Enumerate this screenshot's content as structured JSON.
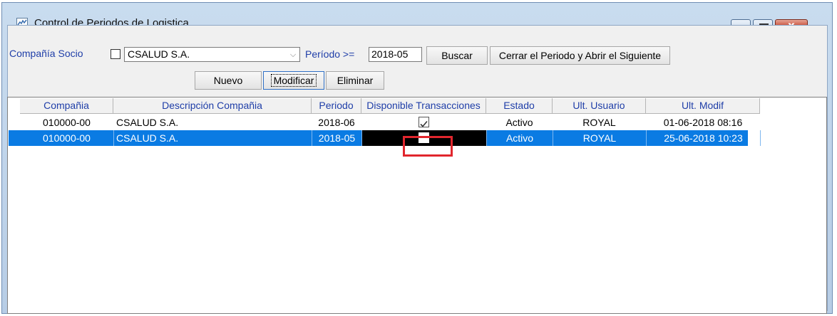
{
  "window": {
    "title": "Control de Periodos de Logistica",
    "close_glyph": "x",
    "icons": [
      "app-icon",
      "minimize-icon",
      "maximize-icon",
      "close-icon"
    ]
  },
  "filters": {
    "compania_socio_label": "Compañía Socio",
    "compania_socio_checked": false,
    "compania_socio_value": "CSALUD S.A.",
    "periodo_label": "Período >=",
    "periodo_value": "2018-05",
    "buscar_label": "Buscar",
    "cerrar_label": "Cerrar el Periodo y Abrir el Siguiente"
  },
  "toolbar": {
    "nuevo_label": "Nuevo",
    "modificar_label": "Modificar",
    "eliminar_label": "Eliminar"
  },
  "grid": {
    "columns": [
      "Compañia",
      "Descripción Compañia",
      "Periodo",
      "Disponible Transacciones",
      "Estado",
      "Ult. Usuario",
      "Ult. Modif"
    ],
    "rows": [
      {
        "compania": "010000-00",
        "descripcion": "CSALUD S.A.",
        "periodo": "2018-06",
        "disponible": true,
        "estado": "Activo",
        "usuario": "ROYAL",
        "modif": "01-06-2018 08:16",
        "selected": false
      },
      {
        "compania": "010000-00",
        "descripcion": "CSALUD S.A.",
        "periodo": "2018-05",
        "disponible": false,
        "estado": "Activo",
        "usuario": "ROYAL",
        "modif": "25-06-2018 10:23",
        "selected": true
      }
    ]
  },
  "colors": {
    "selection": "#0a7be3",
    "highlight": "#e1262d",
    "label_blue": "#1f3ea8"
  }
}
